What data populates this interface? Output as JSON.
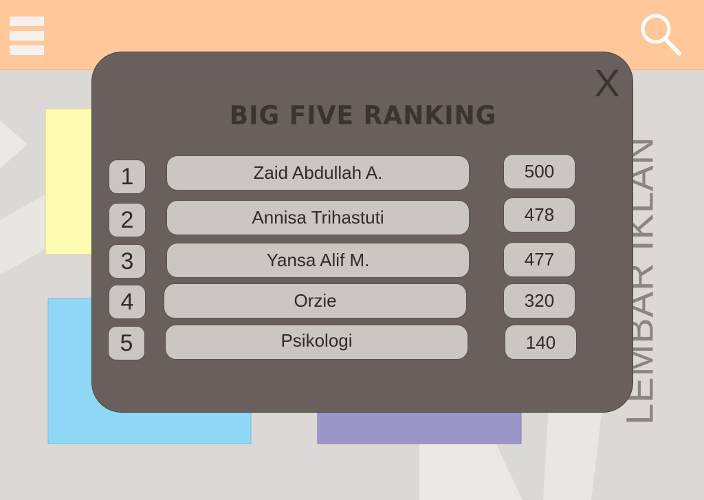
{
  "header": {
    "menu_icon": "hamburger-menu-icon",
    "search_icon": "search-icon"
  },
  "ad": {
    "text": "LEMBAR IKLAN"
  },
  "modal": {
    "title": "BIG FIVE RANKING",
    "close_label": "X",
    "rankings": [
      {
        "rank": "1",
        "name": "Zaid Abdullah A.",
        "score": "500"
      },
      {
        "rank": "2",
        "name": "Annisa Trihastuti",
        "score": "478"
      },
      {
        "rank": "3",
        "name": "Yansa Alif M.",
        "score": "477"
      },
      {
        "rank": "4",
        "name": "Orzie",
        "score": "320"
      },
      {
        "rank": "5",
        "name": "Psikologi",
        "score": "140"
      }
    ]
  },
  "colors": {
    "topbar": "#fec89a",
    "modal": "#695f5d",
    "pill": "#cbc6c3",
    "tile_yellow": "#fffbb0",
    "tile_blue": "#8fd8f5",
    "tile_purple": "#9c96c8"
  }
}
